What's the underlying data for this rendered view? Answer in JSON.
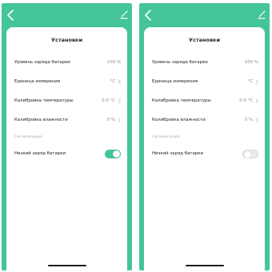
{
  "colors": {
    "accent": "#43c49a",
    "toggle_off": "#ebebeb"
  },
  "screens": [
    {
      "title": "Установки",
      "rows": [
        {
          "label": "Уровень заряда батареи",
          "value": "100 %"
        },
        {
          "label": "Единица измерения",
          "value": "°C"
        },
        {
          "label": "Калибровка температуры",
          "value": "0.0 °C"
        },
        {
          "label": "Калибровка влажности",
          "value": "0 %"
        }
      ],
      "section_header": "Сигнализация",
      "toggle_row": {
        "label": "Низкий заряд батареи",
        "state": "on"
      }
    },
    {
      "title": "Установки",
      "rows": [
        {
          "label": "Уровень заряда батареи",
          "value": "100 %"
        },
        {
          "label": "Единица измерения",
          "value": "°C"
        },
        {
          "label": "Калибровка температуры",
          "value": "0.0 °C"
        },
        {
          "label": "Калибровка влажности",
          "value": "0 %"
        }
      ],
      "section_header": "Сигнализация",
      "toggle_row": {
        "label": "Низкий заряд батареи",
        "state": "off"
      }
    }
  ]
}
